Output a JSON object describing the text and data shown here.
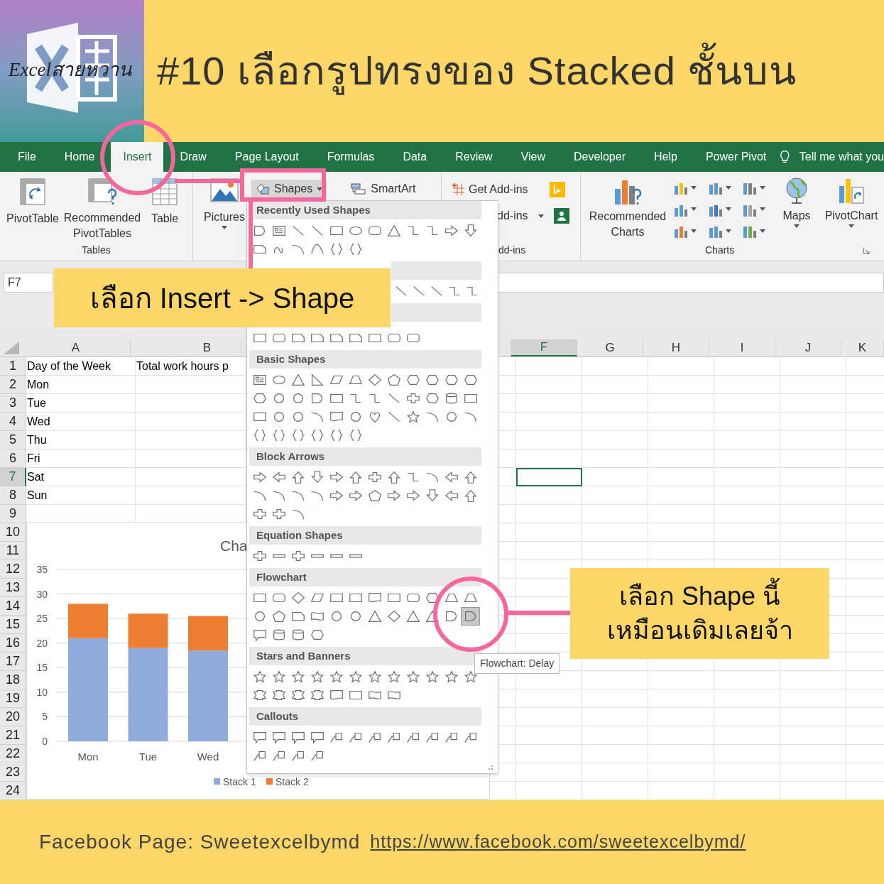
{
  "banner": {
    "logo_text": "Excelสายหวาน",
    "title": "#10 เลือกรูปทรงของ Stacked ชั้นบน"
  },
  "ribbon": {
    "tabs": [
      {
        "label": "File",
        "selected": false
      },
      {
        "label": "Home",
        "selected": false
      },
      {
        "label": "Insert",
        "selected": true
      },
      {
        "label": "Draw",
        "selected": false
      },
      {
        "label": "Page Layout",
        "selected": false
      },
      {
        "label": "Formulas",
        "selected": false
      },
      {
        "label": "Data",
        "selected": false
      },
      {
        "label": "Review",
        "selected": false
      },
      {
        "label": "View",
        "selected": false
      },
      {
        "label": "Developer",
        "selected": false
      },
      {
        "label": "Help",
        "selected": false
      },
      {
        "label": "Power Pivot",
        "selected": false
      }
    ],
    "tell_me": "Tell me what you",
    "tables": {
      "label": "Tables",
      "pivottable": "PivotTable",
      "recommended": "Recommended PivotTables",
      "table": "Table"
    },
    "illustrations": {
      "pictures": "Pictures",
      "shapes": "Shapes",
      "smartart": "SmartArt"
    },
    "addins": {
      "get_addins": "Get Add-ins",
      "addins_button": "dd-ins",
      "label": "dd-ins"
    },
    "charts": {
      "recommended": "Recommended Charts",
      "maps": "Maps",
      "pivotchart": "PivotChart",
      "label": "Charts"
    }
  },
  "formula_bar": {
    "name_box": "F7"
  },
  "sheet": {
    "columns": [
      {
        "label": "A",
        "selected": false
      },
      {
        "label": "B",
        "selected": false
      },
      {
        "label": "F",
        "selected": true
      },
      {
        "label": "G",
        "selected": false
      },
      {
        "label": "H",
        "selected": false
      },
      {
        "label": "I",
        "selected": false
      },
      {
        "label": "J",
        "selected": false
      },
      {
        "label": "K",
        "selected": false
      }
    ],
    "rows": [
      {
        "label": "1",
        "selected": false,
        "cells": [
          "Day of the Week",
          "Total work hours p"
        ]
      },
      {
        "label": "2",
        "selected": false,
        "cells": [
          "Mon"
        ]
      },
      {
        "label": "3",
        "selected": false,
        "cells": [
          "Tue"
        ]
      },
      {
        "label": "4",
        "selected": false,
        "cells": [
          "Wed"
        ]
      },
      {
        "label": "5",
        "selected": false,
        "cells": [
          "Thu"
        ]
      },
      {
        "label": "6",
        "selected": false,
        "cells": [
          "Fri"
        ]
      },
      {
        "label": "7",
        "selected": true,
        "cells": [
          "Sat"
        ]
      },
      {
        "label": "8",
        "selected": false,
        "cells": [
          "Sun"
        ]
      },
      {
        "label": "9",
        "selected": false
      },
      {
        "label": "10",
        "selected": false
      },
      {
        "label": "11",
        "selected": false
      },
      {
        "label": "12",
        "selected": false
      },
      {
        "label": "13",
        "selected": false
      },
      {
        "label": "14",
        "selected": false
      },
      {
        "label": "15",
        "selected": false
      },
      {
        "label": "16",
        "selected": false
      },
      {
        "label": "17",
        "selected": false
      },
      {
        "label": "18",
        "selected": false
      },
      {
        "label": "19",
        "selected": false
      },
      {
        "label": "20",
        "selected": false
      },
      {
        "label": "21",
        "selected": false
      },
      {
        "label": "22",
        "selected": false
      },
      {
        "label": "23",
        "selected": false
      },
      {
        "label": "24",
        "selected": false
      }
    ]
  },
  "chart": {
    "title": "Cha",
    "chart_data": {
      "type": "bar",
      "stacked": true,
      "grid": true,
      "legend": "bottom",
      "categories": [
        "Mon",
        "Tue",
        "Wed"
      ],
      "ylim": [
        0,
        35
      ],
      "yticks": [
        0,
        5,
        10,
        15,
        20,
        25,
        30,
        35
      ],
      "series": [
        {
          "name": "Stack 1",
          "color": "#8faadc",
          "values": [
            21,
            19,
            18.5
          ]
        },
        {
          "name": "Stack 2",
          "color": "#ed7d31",
          "values": [
            7,
            7,
            7
          ]
        }
      ]
    }
  },
  "shapes_menu": {
    "sections": [
      {
        "title": "Recently Used Shapes"
      },
      {
        "title": "Basic Shapes"
      },
      {
        "title": "Block Arrows"
      },
      {
        "title": "Equation Shapes"
      },
      {
        "title": "Flowchart",
        "hovered_shape": {
          "tooltip": "Flowchart: Delay"
        }
      },
      {
        "title": "Stars and Banners"
      },
      {
        "title": "Callouts"
      }
    ]
  },
  "callout_insert": {
    "text": "เลือก Insert -> Shape"
  },
  "callout_shape": {
    "text": "เลือก Shape นี้\nเหมือนเดิมเลยจ้า"
  },
  "footer": {
    "label": "Facebook Page: Sweetexcelbymd",
    "link": "https://www.facebook.com/sweetexcelbymd/"
  }
}
